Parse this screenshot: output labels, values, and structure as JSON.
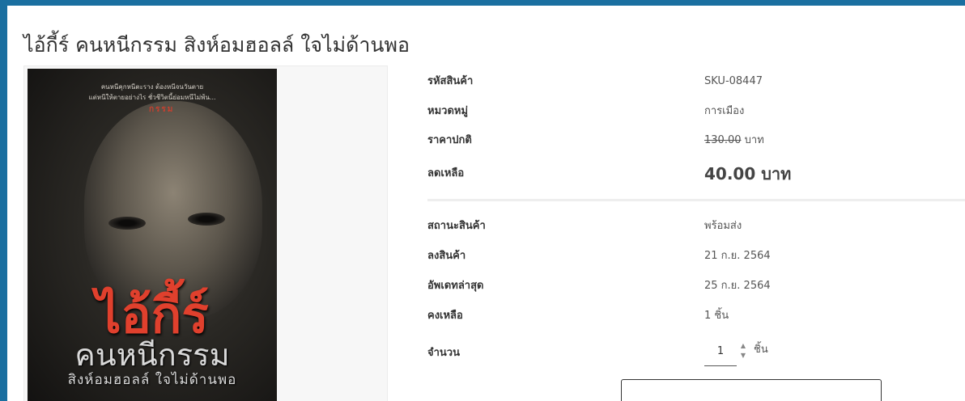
{
  "product": {
    "title": "ไอ้กี้ร์ คนหนีกรรม สิงห์อมฮอลล์ ใจไม่ด้านพอ"
  },
  "cover": {
    "blurb_line1": "คนหนีคุกหนีตะราง ต้องหนีจนวันตาย",
    "blurb_line2": "แต่หนีให้ตายอย่างไร ชั่วชีวิตนี้ย่อมหนีไม่พ้น...",
    "mark": "กรรม",
    "title": "ไอ้กี้ร์",
    "subtitle": "คนหนีกรรม",
    "author": "สิงห์อมฮอลล์ ใจไม่ด้านพอ"
  },
  "details": {
    "sku": {
      "label": "รหัสสินค้า",
      "value": "SKU-08447"
    },
    "category": {
      "label": "หมวดหมู่",
      "value": "การเมือง"
    },
    "regular_price": {
      "label": "ราคาปกติ",
      "value": "130.00",
      "unit": "บาท"
    },
    "sale_price": {
      "label": "ลดเหลือ",
      "value": "40.00 บาท"
    },
    "status": {
      "label": "สถานะสินค้า",
      "value": "พร้อมส่ง"
    },
    "listed": {
      "label": "ลงสินค้า",
      "value": "21 ก.ย. 2564"
    },
    "updated": {
      "label": "อัพเดทล่าสุด",
      "value": "25 ก.ย. 2564"
    },
    "stock": {
      "label": "คงเหลือ",
      "value": "1 ชิ้น"
    },
    "quantity": {
      "label": "จำนวน",
      "value": "1",
      "unit": "ชิ้น"
    }
  },
  "icons": {
    "spin_up": "spinner-up-icon",
    "spin_down": "spinner-down-icon"
  },
  "colors": {
    "header_bar": "#1a6fa0",
    "background": "#ffffff",
    "text_label": "#333333",
    "text_value": "#555555",
    "cover_title": "#e0402d"
  }
}
